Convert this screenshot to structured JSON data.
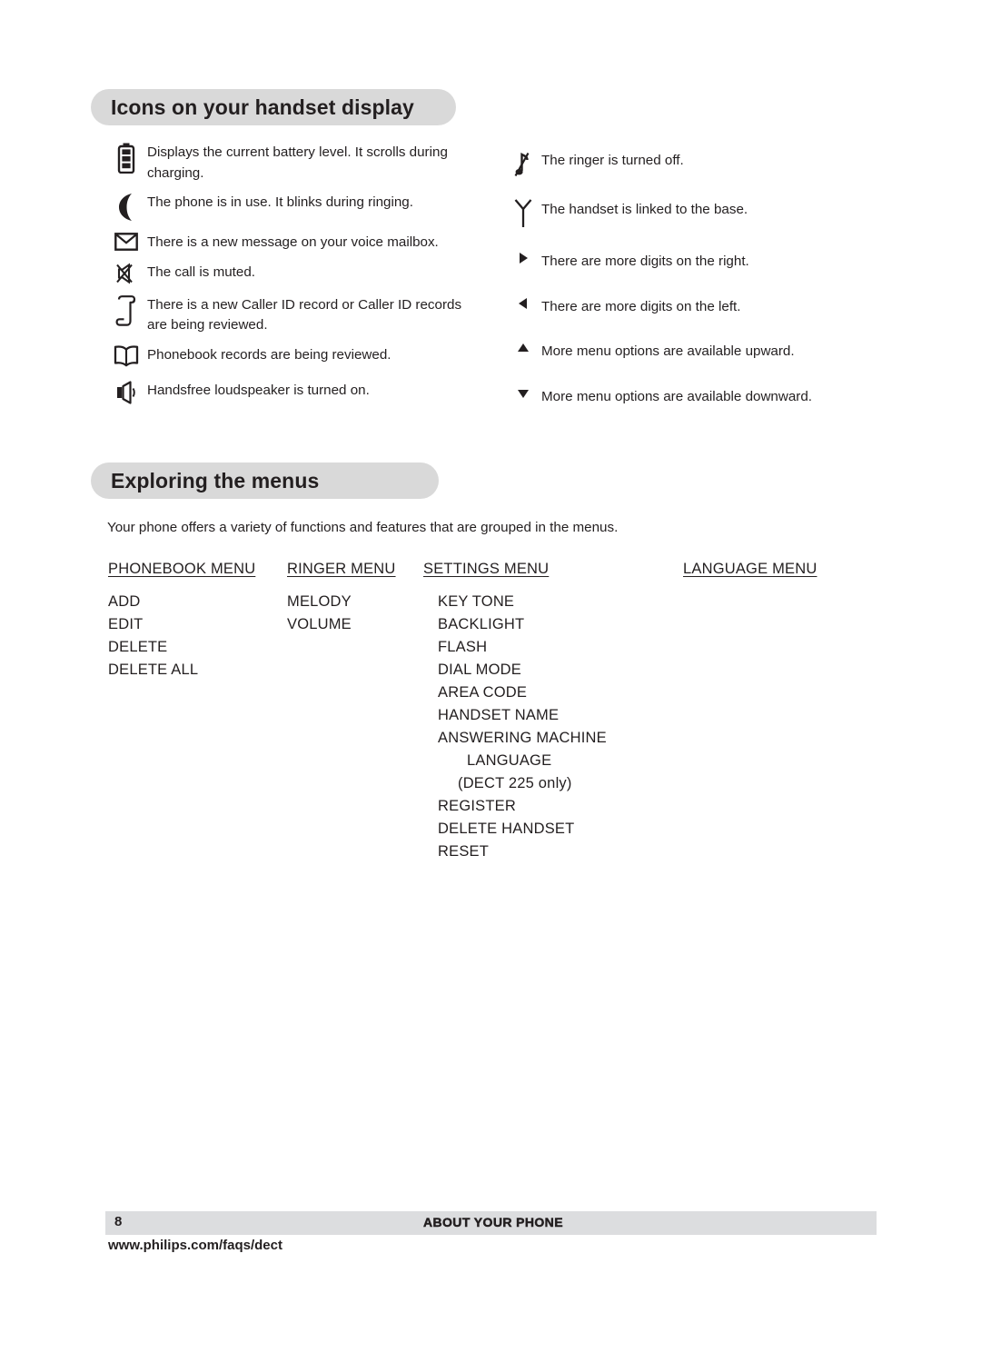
{
  "sections": {
    "icons_heading": "Icons on your handset display",
    "menus_heading": "Exploring the menus",
    "menus_intro": "Your phone offers a variety of functions and features that are grouped in the menus."
  },
  "icon_legend": {
    "left_column": [
      {
        "icon": "battery-icon",
        "description": "Displays the current battery level.  It scrolls during charging."
      },
      {
        "icon": "handset-in-use-icon",
        "description": "The phone is in use.  It blinks during ringing."
      },
      {
        "icon": "voicemail-envelope-icon",
        "description": "There is a new message on your voice mailbox."
      },
      {
        "icon": "mute-icon",
        "description": "The call is muted."
      },
      {
        "icon": "caller-id-scroll-icon",
        "description": "There is a new Caller ID record or Caller ID records are being reviewed."
      },
      {
        "icon": "phonebook-icon",
        "description": "Phonebook records are being reviewed."
      },
      {
        "icon": "loudspeaker-icon",
        "description": "Handsfree loudspeaker is turned on."
      }
    ],
    "right_column": [
      {
        "icon": "ringer-off-icon",
        "description": "The ringer is turned off."
      },
      {
        "icon": "antenna-link-icon",
        "description": "The handset is linked to the base."
      },
      {
        "icon": "arrow-right-icon",
        "description": "There are more digits on the right."
      },
      {
        "icon": "arrow-left-icon",
        "description": "There are more digits on the left."
      },
      {
        "icon": "arrow-up-icon",
        "description": "More menu options are available upward."
      },
      {
        "icon": "arrow-down-icon",
        "description": "More menu options are available downward."
      }
    ]
  },
  "menus": {
    "phonebook": {
      "title": "PHONEBOOK MENU",
      "items": [
        "ADD",
        "EDIT",
        "DELETE",
        "DELETE  ALL"
      ]
    },
    "ringer": {
      "title": "RINGER MENU",
      "items": [
        "MELODY",
        "VOLUME"
      ]
    },
    "settings": {
      "title": "SETTINGS MENU",
      "items": [
        "KEY TONE",
        "BACKLIGHT",
        "FLASH",
        "DIAL MODE",
        "AREA CODE",
        "HANDSET NAME",
        "ANSWERING MACHINE",
        "LANGUAGE",
        "(DECT 225 only)",
        "REGISTER",
        "DELETE HANDSET",
        "RESET"
      ]
    },
    "language": {
      "title": "LANGUAGE MENU",
      "items": []
    }
  },
  "footer": {
    "page_number": "8",
    "section_title": "ABOUT YOUR PHONE",
    "url": "www.philips.com/faqs/dect"
  },
  "colors": {
    "heading_pill": "#d9d9d9",
    "footer_bar": "#dcdddf",
    "text": "#231f20"
  }
}
